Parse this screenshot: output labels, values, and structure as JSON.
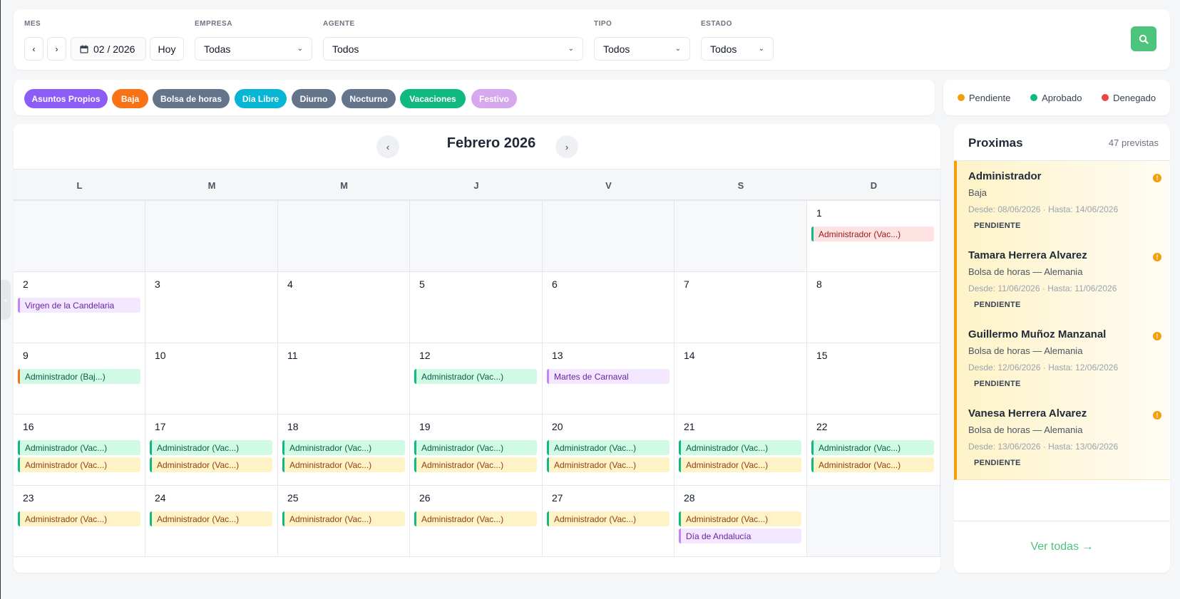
{
  "filters": {
    "mes_label": "MES",
    "empresa_label": "EMPRESA",
    "agente_label": "AGENTE",
    "tipo_label": "TIPO",
    "estado_label": "ESTADO",
    "prev": "‹",
    "next": "›",
    "month_value": "02 / 2026",
    "hoy_label": "Hoy",
    "empresa_value": "Todas",
    "agente_value": "Todos",
    "tipo_value": "Todos",
    "estado_value": "Todos"
  },
  "tags": [
    {
      "label": "Asuntos Propios",
      "color": "#8b5cf6"
    },
    {
      "label": "Baja",
      "color": "#f97316"
    },
    {
      "label": "Bolsa de horas",
      "color": "#64748b"
    },
    {
      "label": "Dia Libre",
      "color": "#06b6d4"
    },
    {
      "label": "Diurno",
      "color": "#64748b"
    },
    {
      "label": "Nocturno",
      "color": "#64748b"
    },
    {
      "label": "Vacaciones",
      "color": "#10b981"
    },
    {
      "label": "Festivo",
      "color": "#d8a8ee"
    }
  ],
  "legend": [
    {
      "label": "Pendiente",
      "color": "#f59e0b"
    },
    {
      "label": "Aprobado",
      "color": "#10b981"
    },
    {
      "label": "Denegado",
      "color": "#ef4444"
    }
  ],
  "calendar": {
    "title": "Febrero 2026",
    "prev": "‹",
    "next": "›",
    "weekdays": [
      "L",
      "M",
      "M",
      "J",
      "V",
      "S",
      "D"
    ],
    "event_styles": {
      "green": {
        "bg": "#d1fae5",
        "border": "#10b981",
        "text": "#065f46"
      },
      "yellow": {
        "bg": "#fef3c7",
        "border": "#10b981",
        "text": "#92400e"
      },
      "red": {
        "bg": "#fee2e2",
        "border": "#10b981",
        "text": "#991b1b"
      },
      "purple": {
        "bg": "#f3e8ff",
        "border": "#c084fc",
        "text": "#6b21a8"
      },
      "orange": {
        "bg": "#d1fae5",
        "border": "#f97316",
        "text": "#065f46"
      }
    },
    "days": [
      {
        "day": "1",
        "col": 6,
        "row": 0,
        "events": [
          {
            "label": "Administrador (Vac...)",
            "style": "red"
          }
        ]
      },
      {
        "day": "2",
        "col": 0,
        "row": 1,
        "events": [
          {
            "label": "Virgen de la Candelaria",
            "style": "purple"
          }
        ]
      },
      {
        "day": "3",
        "col": 1,
        "row": 1,
        "events": []
      },
      {
        "day": "4",
        "col": 2,
        "row": 1,
        "events": []
      },
      {
        "day": "5",
        "col": 3,
        "row": 1,
        "events": []
      },
      {
        "day": "6",
        "col": 4,
        "row": 1,
        "events": []
      },
      {
        "day": "7",
        "col": 5,
        "row": 1,
        "events": []
      },
      {
        "day": "8",
        "col": 6,
        "row": 1,
        "events": []
      },
      {
        "day": "9",
        "col": 0,
        "row": 2,
        "events": [
          {
            "label": "Administrador (Baj...)",
            "style": "orange"
          }
        ]
      },
      {
        "day": "10",
        "col": 1,
        "row": 2,
        "events": []
      },
      {
        "day": "11",
        "col": 2,
        "row": 2,
        "events": []
      },
      {
        "day": "12",
        "col": 3,
        "row": 2,
        "events": [
          {
            "label": "Administrador (Vac...)",
            "style": "green"
          }
        ]
      },
      {
        "day": "13",
        "col": 4,
        "row": 2,
        "events": [
          {
            "label": "Martes de Carnaval",
            "style": "purple"
          }
        ]
      },
      {
        "day": "14",
        "col": 5,
        "row": 2,
        "events": []
      },
      {
        "day": "15",
        "col": 6,
        "row": 2,
        "events": []
      },
      {
        "day": "16",
        "col": 0,
        "row": 3,
        "events": [
          {
            "label": "Administrador (Vac...)",
            "style": "green"
          },
          {
            "label": "Administrador (Vac...)",
            "style": "yellow"
          }
        ]
      },
      {
        "day": "17",
        "col": 1,
        "row": 3,
        "events": [
          {
            "label": "Administrador (Vac...)",
            "style": "green"
          },
          {
            "label": "Administrador (Vac...)",
            "style": "yellow"
          }
        ]
      },
      {
        "day": "18",
        "col": 2,
        "row": 3,
        "events": [
          {
            "label": "Administrador (Vac...)",
            "style": "green"
          },
          {
            "label": "Administrador (Vac...)",
            "style": "yellow"
          }
        ]
      },
      {
        "day": "19",
        "col": 3,
        "row": 3,
        "events": [
          {
            "label": "Administrador (Vac...)",
            "style": "green"
          },
          {
            "label": "Administrador (Vac...)",
            "style": "yellow"
          }
        ]
      },
      {
        "day": "20",
        "col": 4,
        "row": 3,
        "events": [
          {
            "label": "Administrador (Vac...)",
            "style": "green"
          },
          {
            "label": "Administrador (Vac...)",
            "style": "yellow"
          }
        ]
      },
      {
        "day": "21",
        "col": 5,
        "row": 3,
        "events": [
          {
            "label": "Administrador (Vac...)",
            "style": "green"
          },
          {
            "label": "Administrador (Vac...)",
            "style": "yellow"
          }
        ]
      },
      {
        "day": "22",
        "col": 6,
        "row": 3,
        "events": [
          {
            "label": "Administrador (Vac...)",
            "style": "green"
          },
          {
            "label": "Administrador (Vac...)",
            "style": "yellow"
          }
        ]
      },
      {
        "day": "23",
        "col": 0,
        "row": 4,
        "events": [
          {
            "label": "Administrador (Vac...)",
            "style": "yellow"
          }
        ]
      },
      {
        "day": "24",
        "col": 1,
        "row": 4,
        "events": [
          {
            "label": "Administrador (Vac...)",
            "style": "yellow"
          }
        ]
      },
      {
        "day": "25",
        "col": 2,
        "row": 4,
        "events": [
          {
            "label": "Administrador (Vac...)",
            "style": "yellow"
          }
        ]
      },
      {
        "day": "26",
        "col": 3,
        "row": 4,
        "events": [
          {
            "label": "Administrador (Vac...)",
            "style": "yellow"
          }
        ]
      },
      {
        "day": "27",
        "col": 4,
        "row": 4,
        "events": [
          {
            "label": "Administrador (Vac...)",
            "style": "yellow"
          }
        ]
      },
      {
        "day": "28",
        "col": 5,
        "row": 4,
        "events": [
          {
            "label": "Administrador (Vac...)",
            "style": "yellow"
          },
          {
            "label": "Día de Andalucía",
            "style": "purple"
          }
        ]
      }
    ],
    "empty_cells": [
      {
        "col": 0,
        "row": 0
      },
      {
        "col": 1,
        "row": 0
      },
      {
        "col": 2,
        "row": 0
      },
      {
        "col": 3,
        "row": 0
      },
      {
        "col": 4,
        "row": 0
      },
      {
        "col": 5,
        "row": 0
      },
      {
        "col": 6,
        "row": 4
      }
    ]
  },
  "upcoming": {
    "title": "Proximas",
    "count": "47 previstas",
    "items": [
      {
        "name": "Administrador",
        "type": "Baja",
        "dates": "Desde: 08/06/2026 · Hasta: 14/06/2026",
        "status": "PENDIENTE"
      },
      {
        "name": "Tamara Herrera Alvarez",
        "type": "Bolsa de horas — Alemania",
        "dates": "Desde: 11/06/2026 · Hasta: 11/06/2026",
        "status": "PENDIENTE"
      },
      {
        "name": "Guillermo Muñoz Manzanal",
        "type": "Bolsa de horas — Alemania",
        "dates": "Desde: 12/06/2026 · Hasta: 12/06/2026",
        "status": "PENDIENTE"
      },
      {
        "name": "Vanesa Herrera Alvarez",
        "type": "Bolsa de horas — Alemania",
        "dates": "Desde: 13/06/2026 · Hasta: 13/06/2026",
        "status": "PENDIENTE"
      }
    ],
    "see_all": "Ver todas →"
  }
}
